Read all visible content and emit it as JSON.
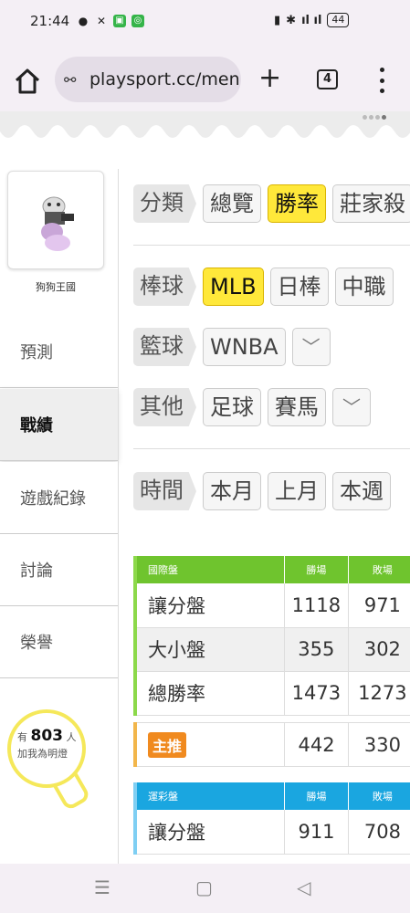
{
  "status": {
    "time": "21:44",
    "battery": "44"
  },
  "browser": {
    "url": "playsport.cc/men",
    "tabs_count": "4"
  },
  "sidebar": {
    "username": "狗狗王國",
    "items": [
      {
        "label": "預測"
      },
      {
        "label": "戰績",
        "active": true
      },
      {
        "label": "遊戲紀錄"
      },
      {
        "label": "討論"
      },
      {
        "label": "榮譽"
      }
    ],
    "fans": {
      "prefix": "有",
      "count": "803",
      "suffix": "人",
      "line2": "加我為明燈"
    }
  },
  "filters": {
    "category": {
      "label": "分類",
      "options": [
        "總覽",
        "勝率",
        "莊家殺"
      ]
    },
    "baseball": {
      "label": "棒球",
      "options": [
        "MLB",
        "日棒",
        "中職"
      ]
    },
    "basketball": {
      "label": "籃球",
      "options": [
        "WNBA"
      ]
    },
    "other": {
      "label": "其他",
      "options": [
        "足球",
        "賽馬"
      ]
    },
    "time": {
      "label": "時間",
      "options": [
        "本月",
        "上月",
        "本週"
      ]
    },
    "dropdown_icon": "chevron-down"
  },
  "table_intl": {
    "header": [
      "國際盤",
      "勝場",
      "敗場"
    ],
    "rows": [
      [
        "讓分盤",
        "1118",
        "971"
      ],
      [
        "大小盤",
        "355",
        "302"
      ],
      [
        "總勝率",
        "1473",
        "1273"
      ]
    ]
  },
  "table_main": {
    "label": "主推",
    "wins": "442",
    "losses": "330"
  },
  "table_lottery": {
    "header": [
      "運彩盤",
      "勝場",
      "敗場"
    ],
    "rows": [
      [
        "讓分盤",
        "911",
        "708"
      ]
    ]
  },
  "colors": {
    "selected": "#ffe83a",
    "intl_header": "#6fc42e",
    "lottery_header": "#1aa6e0",
    "badge": "#f08a1f"
  }
}
